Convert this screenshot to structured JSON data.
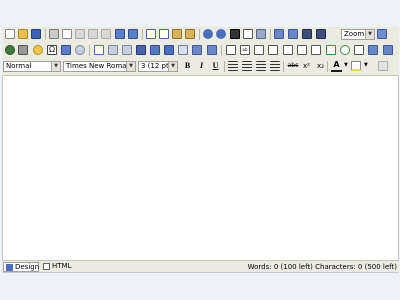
{
  "toolbar": {
    "zoom_label": "Zoom",
    "style_select": "Normal",
    "font_select": "Times New Roman",
    "size_select": "3 (12 pt)",
    "bold_label": "B",
    "italic_label": "I",
    "underline_label": "U",
    "strikethrough_label": "abc",
    "superscript_label": "x²",
    "subscript_label": "x₂",
    "font_color_label": "A"
  },
  "statusbar": {
    "design_tab": "Design",
    "html_tab": "HTML",
    "status": "Words: 0 (100 left) Characters: 0 (500 left)"
  },
  "colors": {
    "toolbar_bg": "#ecebe1",
    "page_bg": "#eef3f8",
    "editor_bg": "#ffffff"
  }
}
